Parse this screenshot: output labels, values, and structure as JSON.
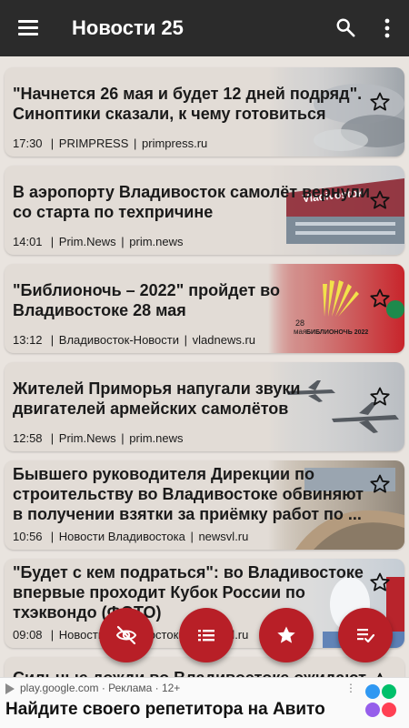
{
  "app": {
    "title": "Новости 25"
  },
  "news": [
    {
      "title": "\"Начнется 26 мая и будет 12 дней подряд\". Синоптики сказали, к чему готовиться",
      "time": "17:30",
      "source": "PRIMPRESS",
      "domain": "primpress.ru"
    },
    {
      "title": "В аэропорту Владивосток самолёт вернули со старта по техпричине",
      "time": "14:01",
      "source": "Prim.News",
      "domain": "prim.news",
      "thumb_text": "Vladivostok"
    },
    {
      "title": "\"Библионочь – 2022\" пройдет во Владивостоке 28 мая",
      "time": "13:12",
      "source": "Владивосток-Новости",
      "domain": "vladnews.ru",
      "thumb_text_1": "28",
      "thumb_text_2": "мая",
      "thumb_text_3": "БИБЛИОНОЧЬ 2022"
    },
    {
      "title": "Жителей Приморья напугали звуки двигателей армейских самолётов",
      "time": "12:58",
      "source": "Prim.News",
      "domain": "prim.news"
    },
    {
      "title": "Бывшего руководителя Дирекции по строительству во Владивостоке обвиняют в получении взятки за приёмку работ по ...",
      "time": "10:56",
      "source": "Новости Владивостока",
      "domain": "newsvl.ru"
    },
    {
      "title": "\"Будет с кем подраться\": во Владивостоке впервые проходит Кубок России по тхэквондо (ФОТО)",
      "time": "09:08",
      "source": "Новости Владивостока",
      "domain": "newsvl.ru"
    },
    {
      "title": "Сильные дожди во Владивостоке ожидают",
      "time": "",
      "source": "",
      "domain": ""
    }
  ],
  "ad": {
    "source": "play.google.com · Реклама · 12+",
    "headline": "Найдите своего репетитора на Авито"
  },
  "colors": {
    "appbar": "#2b2b2b",
    "accent": "#b81f27",
    "background": "#e9e4df",
    "card": "#e2dcd6"
  },
  "fabs": [
    "hide-icon",
    "list-icon",
    "star-icon",
    "playlist-check-icon"
  ]
}
